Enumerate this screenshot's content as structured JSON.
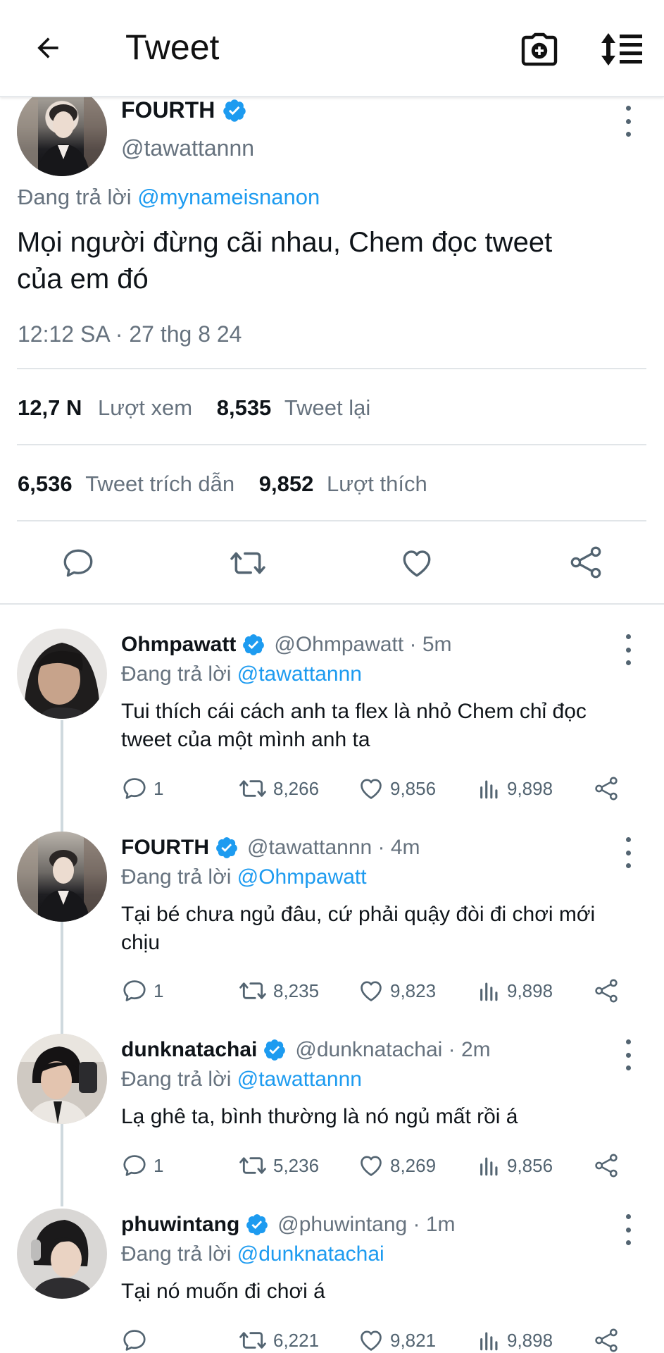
{
  "topbar": {
    "title": "Tweet",
    "icons": [
      "arrow-left-icon",
      "camera-plus-icon",
      "sort-list-icon"
    ]
  },
  "main_tweet": {
    "display_name": "FOURTH",
    "handle": "@tawattannn",
    "replying_prefix": "Đang trả lời",
    "replying_to": "@mynameisnanon",
    "text_line1": "Mọi người đừng cãi nhau, Chem đọc tweet",
    "text_line2": "của em đó",
    "timestamp": "12:12 SA · 27 thg 8 24",
    "stats": {
      "views_value": "12,7 N",
      "views_label": "Lượt xem",
      "retweets_value": "8,535",
      "retweets_label": "Tweet lại",
      "quotes_value": "6,536",
      "quotes_label": "Tweet trích dẫn",
      "likes_value": "9,852",
      "likes_label": "Lượt thích"
    }
  },
  "replies": [
    {
      "display_name": "Ohmpawatt",
      "handle_time": "@Ohmpawatt · 5m",
      "replying_prefix": "Đang trả lời",
      "replying_to": "@tawattannn",
      "text": "Tui thích cái cách anh ta flex là nhỏ Chem chỉ đọc tweet của một mình anh ta",
      "replies": "1",
      "retweets": "8,266",
      "likes": "9,856",
      "views": "9,898"
    },
    {
      "display_name": "FOURTH",
      "handle_time": "@tawattannn · 4m",
      "replying_prefix": "Đang trả lời",
      "replying_to": "@Ohmpawatt",
      "text": "Tại bé chưa ngủ đâu, cứ phải quậy đòi đi chơi mới chịu",
      "replies": "1",
      "retweets": "8,235",
      "likes": "9,823",
      "views": "9,898"
    },
    {
      "display_name": "dunknatachai",
      "handle_time": "@dunknatachai · 2m",
      "replying_prefix": "Đang trả lời",
      "replying_to": "@tawattannn",
      "text": "Lạ ghê ta, bình thường là nó ngủ mất rồi á",
      "replies": "1",
      "retweets": "5,236",
      "likes": "8,269",
      "views": "9,856"
    },
    {
      "display_name": "phuwintang",
      "handle_time": "@phuwintang · 1m",
      "replying_prefix": "Đang trả lời",
      "replying_to": "@dunknatachai",
      "text": "Tại nó muốn đi chơi á",
      "replies": "",
      "retweets": "6,221",
      "likes": "9,821",
      "views": "9,898"
    }
  ],
  "colors": {
    "link": "#1d9bf0",
    "muted": "#66727e",
    "verified": "#1d9bf0",
    "divider": "#e1e5e8"
  }
}
